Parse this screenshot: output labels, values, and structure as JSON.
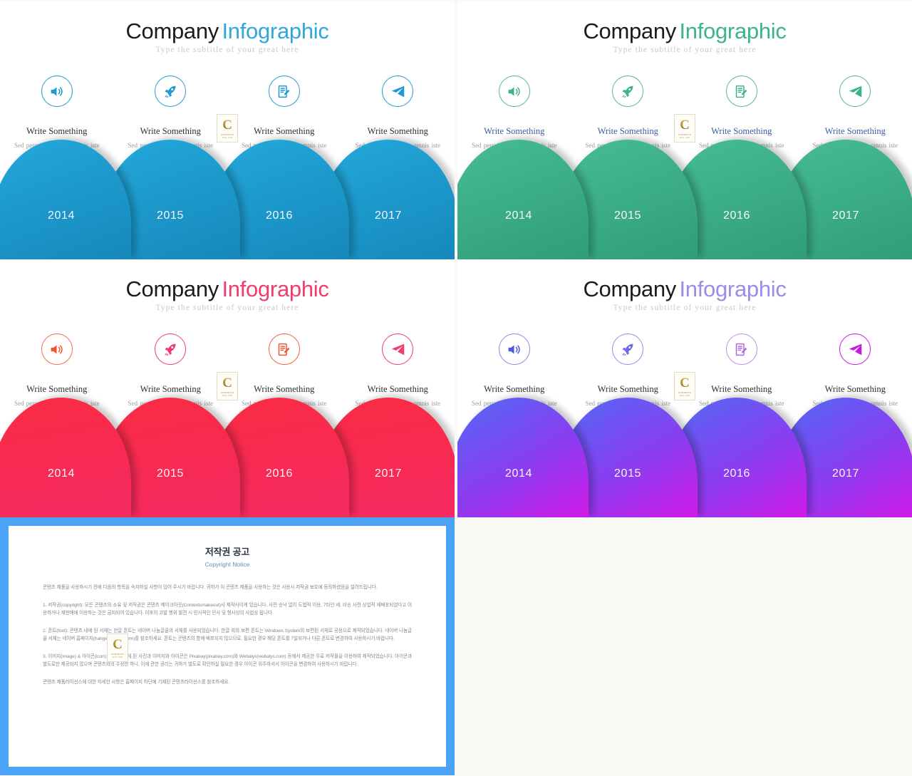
{
  "page": {
    "background": "#faf9f5",
    "watermark": {
      "letter": "C",
      "line1": "CONTENTS",
      "line2": "MALL .COM"
    }
  },
  "slides": [
    {
      "id": "slide-blue",
      "title_main": "Company",
      "title_accent": "Infographic",
      "accent_color": "#2fa7dd",
      "heading_color": "#2e2e2e",
      "subtitle": "Type the subtitle of your great here",
      "icon_border": "#1f9bd1",
      "icon_color": "#1f9bd1",
      "dome_from": "#1aa3d6",
      "dome_to": "#1687bb",
      "dot_color": "#9b9b9b",
      "columns": [
        {
          "icon": "speaker-icon",
          "head": "Write Something",
          "body": "Sed perspiciatis unde omnis iste voluptatem fringilla."
        },
        {
          "icon": "rocket-icon",
          "head": "Write Something",
          "body": "Sed perspiciatis unde omnis iste voluptatem fringilla."
        },
        {
          "icon": "document-edit-icon",
          "head": "Write Something",
          "body": "Sed perspiciatis unde omnis iste voluptatem fringilla."
        },
        {
          "icon": "paper-plane-icon",
          "head": "Write Something",
          "body": "Sed perspiciatis unde omnis iste voluptatem fringilla."
        }
      ],
      "years": [
        "2014",
        "2015",
        "2016",
        "2017"
      ]
    },
    {
      "id": "slide-green",
      "title_main": "Company",
      "title_accent": "Infographic",
      "accent_color": "#3cb48a",
      "heading_color": "#3d5a9e",
      "subtitle": "Type the subtitle of your great here",
      "icon_border": "#4cb98f",
      "icon_color": "#3cb48a",
      "dome_from": "#3fb58d",
      "dome_to": "#2f9d79",
      "dot_color": "#7d8fb5",
      "columns": [
        {
          "icon": "speaker-icon",
          "head": "Write Something",
          "body": "Sed perspiciatis unde omnis iste voluptatem fringilla."
        },
        {
          "icon": "rocket-icon",
          "head": "Write Something",
          "body": "Sed perspiciatis unde omnis iste voluptatem fringilla."
        },
        {
          "icon": "document-edit-icon",
          "head": "Write Something",
          "body": "Sed perspiciatis unde omnis iste voluptatem fringilla."
        },
        {
          "icon": "paper-plane-icon",
          "head": "Write Something",
          "body": "Sed perspiciatis unde omnis iste voluptatem fringilla."
        }
      ],
      "years": [
        "2014",
        "2015",
        "2016",
        "2017"
      ]
    },
    {
      "id": "slide-red",
      "title_main": "Company",
      "title_accent": "Infographic",
      "accent_color": "#ef3d6e",
      "heading_color": "#2e2e2e",
      "subtitle": "Type the subtitle of your great here",
      "icon_border": "#f0466d",
      "icon_color": "#f4542f",
      "dome_from": "#fa2b46",
      "dome_to": "#f5285e",
      "dot_color": "#9b9b9b",
      "columns": [
        {
          "icon": "speaker-icon",
          "head": "Write Something",
          "body": "Sed perspiciatis unde omnis iste voluptatem fringilla."
        },
        {
          "icon": "rocket-icon",
          "head": "Write Something",
          "body": "Sed perspiciatis unde omnis iste voluptatem fringilla."
        },
        {
          "icon": "document-edit-icon",
          "head": "Write Something",
          "body": "Sed perspiciatis unde omnis iste voluptatem fringilla."
        },
        {
          "icon": "paper-plane-icon",
          "head": "Write Something",
          "body": "Sed perspiciatis unde omnis iste voluptatem fringilla."
        }
      ],
      "years": [
        "2014",
        "2015",
        "2016",
        "2017"
      ]
    },
    {
      "id": "slide-purple",
      "title_main": "Company",
      "title_accent": "Infographic",
      "accent_color": "#9b8ce8",
      "heading_color": "#2e2e2e",
      "subtitle": "Type the subtitle of your great here",
      "icon_border": "#9a8ce6",
      "icon_color": "#5a63e0",
      "dome_from": "#5b5bf0",
      "dome_to": "#d11ae8",
      "dot_color": "#b0b0b0",
      "columns": [
        {
          "icon": "speaker-icon",
          "head": "Write Something",
          "body": "Sed perspiciatis unde omnis iste voluptatem fringilla."
        },
        {
          "icon": "rocket-icon",
          "head": "Write Something",
          "body": "Sed perspiciatis unde omnis iste voluptatem fringilla."
        },
        {
          "icon": "document-edit-icon",
          "head": "Write Something",
          "body": "Sed perspiciatis unde omnis iste voluptatem fringilla."
        },
        {
          "icon": "paper-plane-icon",
          "head": "Write Something",
          "body": "Sed perspiciatis unde omnis iste voluptatem fringilla."
        }
      ],
      "years": [
        "2014",
        "2015",
        "2016",
        "2017"
      ]
    }
  ],
  "copyright": {
    "frame_color": "#4aa3f5",
    "title": "저작권 공고",
    "subtitle": "Copyright Notice",
    "paragraphs": [
      "콘텐츠 제품을 사용하시기 전에 다음의 항목을 숙지하실 사항이 있어 주시기 바랍니다. 귀하가 이 콘텐츠 제품을 사용하는 것은 사용시 저작권 보호에 동의하셨음을 알려드립니다.",
      "1. 저작권(copyright): 모든 콘텐츠의 소유 및 저작권은 콘텐츠 메이크아웃(Contentsmakeout)사 제작사이게 있습니다. 사전 승낙 없이 도법적 이용, 7타인 세, 비송 사전 상업적 재배포되었다고 이용하거나 재판매에 이용하는 것은 금지되어 있습니다. 이후의 고발 행위 발견 시 민사적인 민사 및 형사상의 사법상 됩니다.",
      "2. 폰트(font): 콘텐츠 내에 된 서체는 한글 폰트는 네이버 나눔글꼴의 서체를 사용되었습니다. 한글 외의 보편 폰트는 Windows System의 보편된 서체로 공용으로 제작되었습니다. 네이버 나눔글꼴 서체는 네이버 홈페이지(hangeul.naver.com)를 참조하세요. 폰트는 콘텐츠의 함께 배포되지 않으므로, 필요한 경우 해당 폰트를 7일되거나 다른 폰트로 변경하여 사용하시기 바랍니다.",
      "3. 이미지(image) & 아이콘(icon): 콘텐츠 내에 된 사진과 이미지와 아이콘은 Pixabay(pixabay.com)와 Webalys(webalys.com) 등에서 제공한 무료 저작물을 이용하여 제작되었습니다. 아이콘과 별도로만 제공되지 않으며 콘텐츠와의 수정한 하니, 이에 관한 권리는 귀하가 별도로 확인하실 필요한 경우 아이콘 위주하셔서 아이콘을 변경하여 사용하시기 바랍니다.",
      "콘텐츠 제품라이선스에 대한 자세한 사항은 홈페이지 하단에 기재된 콘텐츠라이선스를 참조하세요."
    ]
  }
}
